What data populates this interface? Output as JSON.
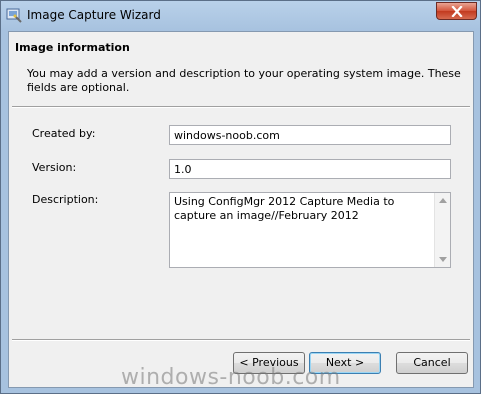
{
  "window": {
    "title": "Image Capture Wizard"
  },
  "page": {
    "heading": "Image information",
    "description": "You may add a version and description to your operating system image.  These fields are optional."
  },
  "form": {
    "created_by_label": "Created by:",
    "created_by_value": "windows-noob.com",
    "version_label": "Version:",
    "version_value": "1.0",
    "description_label": "Description:",
    "description_value": "Using ConfigMgr 2012 Capture Media to capture an image//February 2012"
  },
  "buttons": {
    "previous": "< Previous",
    "next": "Next >",
    "cancel": "Cancel"
  },
  "watermark": "windows-noob.com",
  "icons": {
    "app": "wizard-app-icon",
    "close": "close-icon",
    "scroll_up": "scroll-up-arrow-icon",
    "scroll_down": "scroll-down-arrow-icon"
  }
}
